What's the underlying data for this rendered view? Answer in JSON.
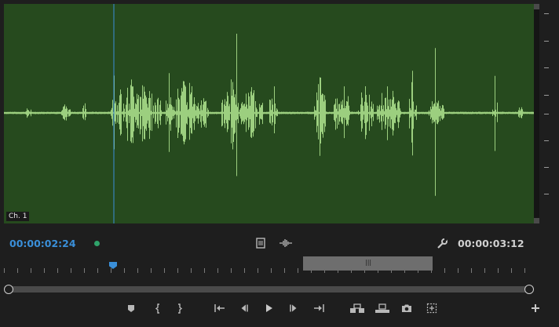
{
  "channel_label": "Ch. 1",
  "timecode_current": "00:00:02:24",
  "timecode_duration": "00:00:03:12",
  "colors": {
    "waveform_bg": "#264a1e",
    "waveform": "#9ccf7f",
    "accent": "#3a8fd9",
    "status_dot": "#2fa36a"
  },
  "playhead_fraction": 0.2,
  "icons": {
    "safe_margins": "safe-margins-icon",
    "audio_waveform_toggle": "waveform-toggle-icon",
    "settings": "wrench-icon",
    "marker": "add-marker-icon",
    "mark_in": "mark-in-icon",
    "mark_out": "mark-out-icon",
    "go_to_in": "go-to-in-icon",
    "step_back": "step-back-icon",
    "play": "play-icon",
    "step_forward": "step-forward-icon",
    "go_to_out": "go-to-out-icon",
    "insert": "insert-icon",
    "overwrite": "overwrite-icon",
    "export_frame": "camera-icon",
    "drag_video_audio": "drag-audio-icon",
    "add_button": "plus-icon"
  }
}
